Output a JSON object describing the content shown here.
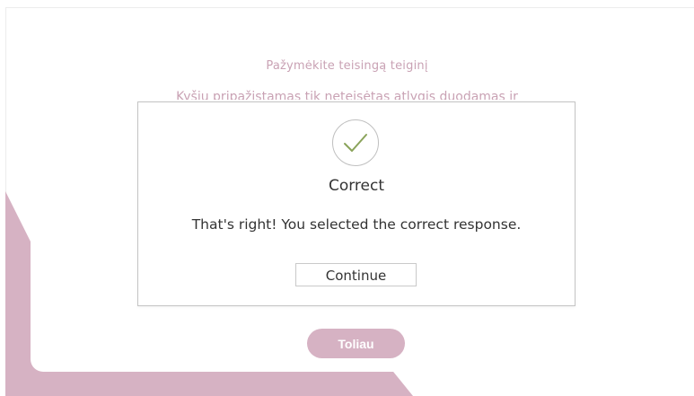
{
  "colors": {
    "accent": "#d6b2c3",
    "accent_text": "#c9a2b4",
    "check": "#8aa35a",
    "modal_text": "#333333"
  },
  "quiz": {
    "title": "Pažymėkite teisingą teiginį",
    "question_partial": "Kyšiu pripažįstamas tik neteisėtas atlygis duodamas ir",
    "next_label": "Toliau"
  },
  "modal": {
    "icon": "checkmark-icon",
    "title": "Correct",
    "message": "That's right!  You selected the correct response.",
    "continue_label": "Continue"
  }
}
